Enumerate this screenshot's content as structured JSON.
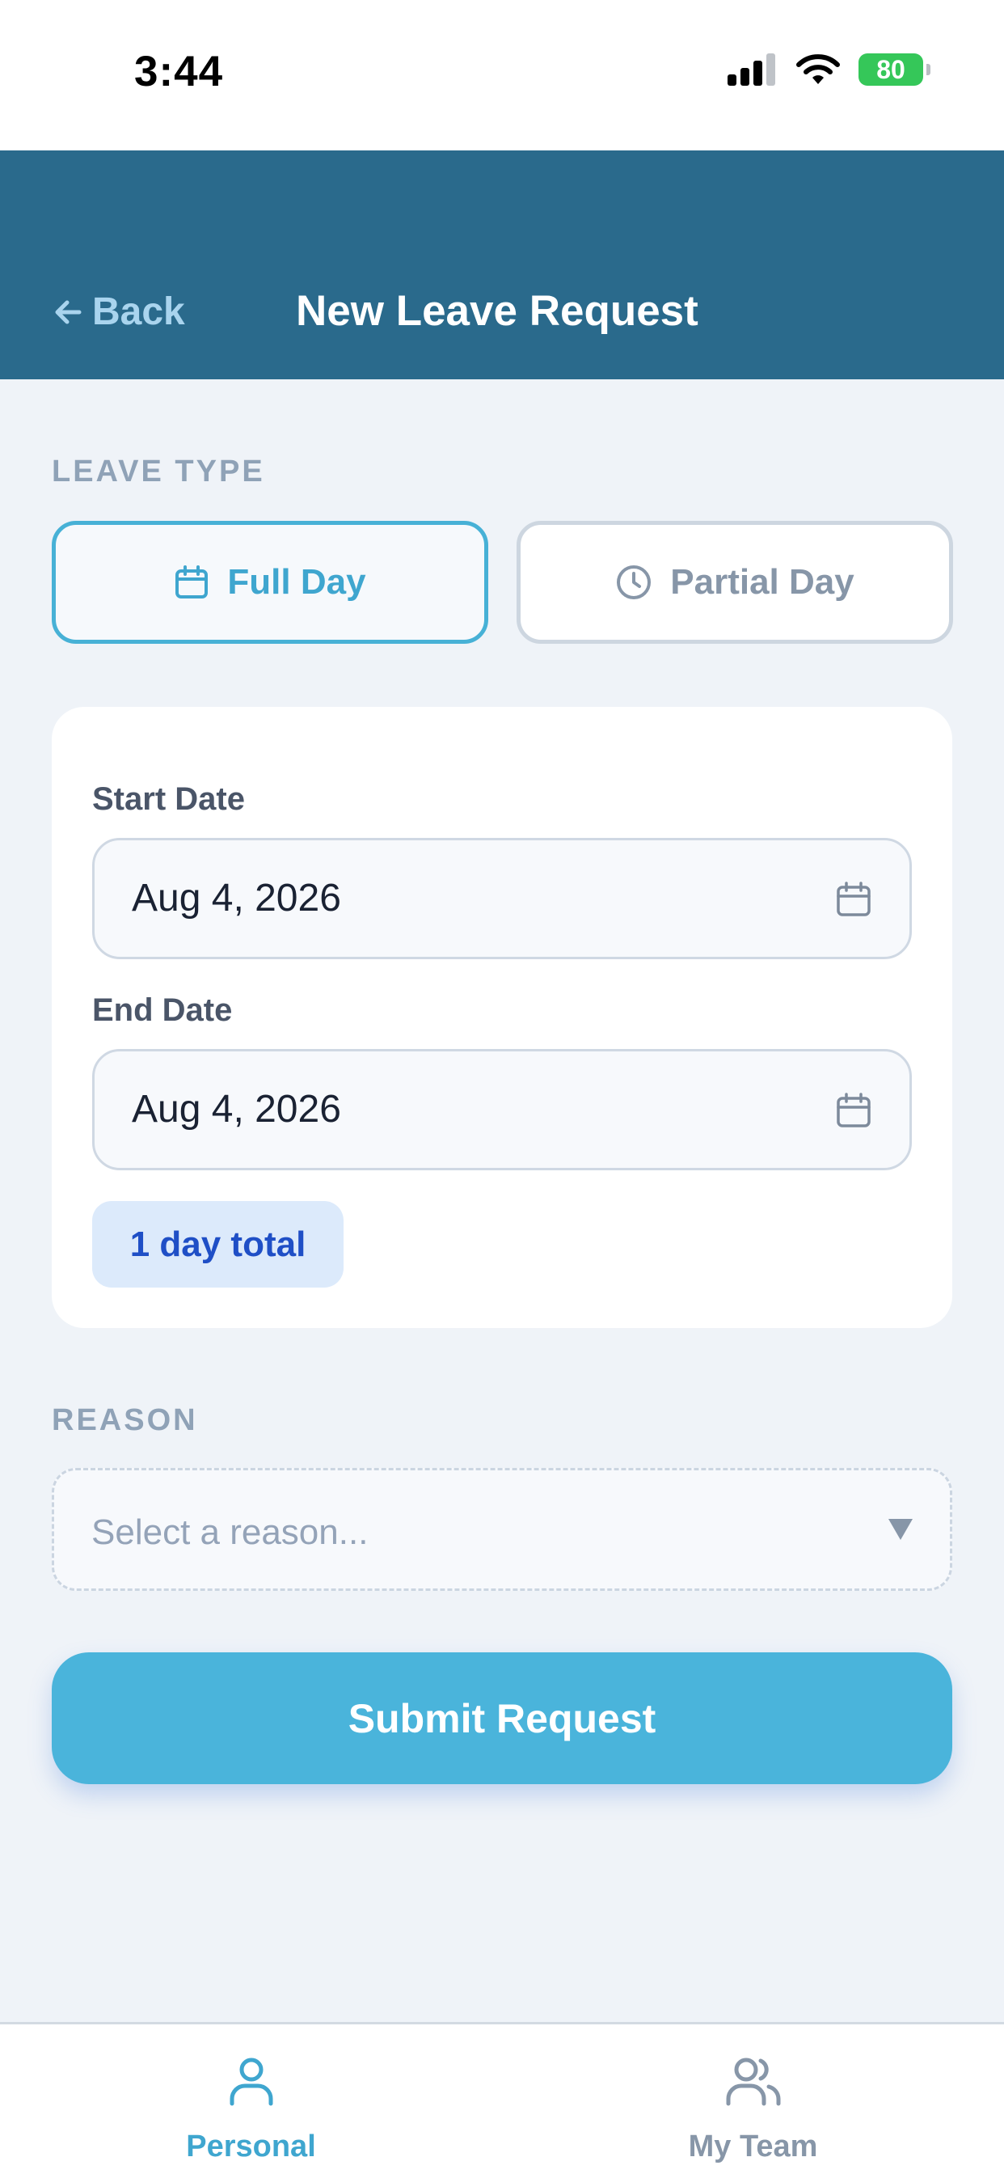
{
  "status_bar": {
    "time": "3:44",
    "battery": "80"
  },
  "header": {
    "back_label": "Back",
    "title": "New Leave Request"
  },
  "leave_type": {
    "section_label": "LEAVE TYPE",
    "options": [
      {
        "label": "Full Day",
        "icon": "calendar-icon",
        "selected": true
      },
      {
        "label": "Partial Day",
        "icon": "clock-icon",
        "selected": false
      }
    ]
  },
  "dates": {
    "start_label": "Start Date",
    "start_value": "Aug 4, 2026",
    "end_label": "End Date",
    "end_value": "Aug 4, 2026",
    "total": "1 day total"
  },
  "reason": {
    "section_label": "REASON",
    "placeholder": "Select a reason..."
  },
  "submit_label": "Submit Request",
  "tabs": [
    {
      "label": "Personal",
      "icon": "person-icon",
      "active": true
    },
    {
      "label": "My Team",
      "icon": "team-icon",
      "active": false
    }
  ],
  "colors": {
    "header_bg": "#2A6A8C",
    "accent": "#47B1D6",
    "badge_bg": "#DCEAFB",
    "badge_text": "#1F4FC6",
    "battery": "#35C759"
  }
}
